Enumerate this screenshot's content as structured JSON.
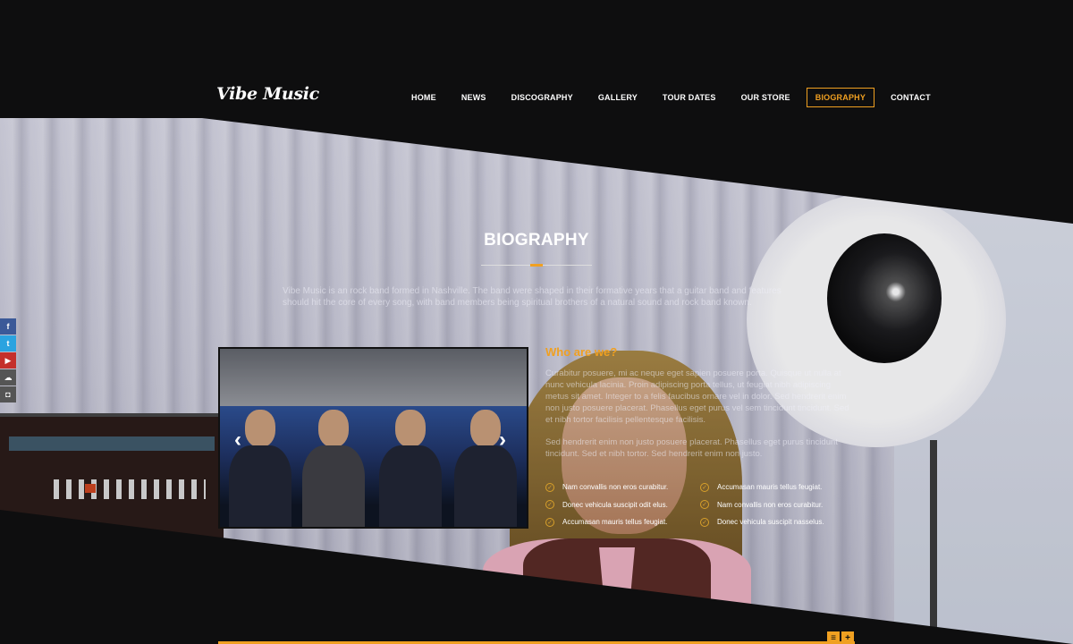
{
  "brand": {
    "logo": "Vibe Music"
  },
  "nav": {
    "items": [
      {
        "label": "HOME"
      },
      {
        "label": "NEWS"
      },
      {
        "label": "DISCOGRAPHY"
      },
      {
        "label": "GALLERY"
      },
      {
        "label": "TOUR DATES"
      },
      {
        "label": "OUR STORE"
      },
      {
        "label": "BIOGRAPHY",
        "active": true
      },
      {
        "label": "CONTACT"
      }
    ]
  },
  "section": {
    "title": "BIOGRAPHY",
    "intro": "Vibe Music is an rock band formed in Nashville. The band were shaped in their formative years that a guitar band and features should hit the core of every song, with band members being spiritual brothers of a natural sound and rock band known."
  },
  "carousel": {
    "prev_icon": "‹",
    "next_icon": "›"
  },
  "about": {
    "heading": "Who are we?",
    "paragraphs": [
      "Curabitur posuere, mi ac neque eget sapien posuere porta. Quisque ut nulla at nunc vehicula lacinia. Proin adipiscing porta tellus, ut feugiat nibh adipiscing metus sit amet. Integer to a felis faucibus ornare vel in dolor. Sed hendrerit enim non justo posuere placerat. Phasellus eget purus vel sem tincidunt tincidunt. Sed et nibh tortor facilisis pellentesque facilisis.",
      "Sed hendrerit enim non justo posuere placerat. Phasellus eget purus tincidunt tincidunt. Sed et nibh tortor. Sed hendrerit enim non justo."
    ],
    "features_left": [
      "Nam convallis non eros curabitur.",
      "Donec vehicula suscipit odit elus.",
      "Accumasan mauris tellus feugiat."
    ],
    "features_right": [
      "Accumasan mauris tellus feugiat.",
      "Nam convallis non eros curabitur.",
      "Donec vehicula suscipit nasselus."
    ]
  },
  "social": [
    {
      "icon": "facebook-icon",
      "glyph": "f",
      "color": "#3b5998"
    },
    {
      "icon": "twitter-icon",
      "glyph": "t",
      "color": "#2aa3e0"
    },
    {
      "icon": "youtube-icon",
      "glyph": "▶",
      "color": "#c4302b"
    },
    {
      "icon": "soundcloud-icon",
      "glyph": "☁",
      "color": "#555555"
    },
    {
      "icon": "instagram-icon",
      "glyph": "◘",
      "color": "#555555"
    }
  ],
  "footer_controls": {
    "menu_icon": "≡",
    "plus_icon": "+"
  },
  "colors": {
    "accent": "#f0a021",
    "background": "#0e0e0f"
  }
}
